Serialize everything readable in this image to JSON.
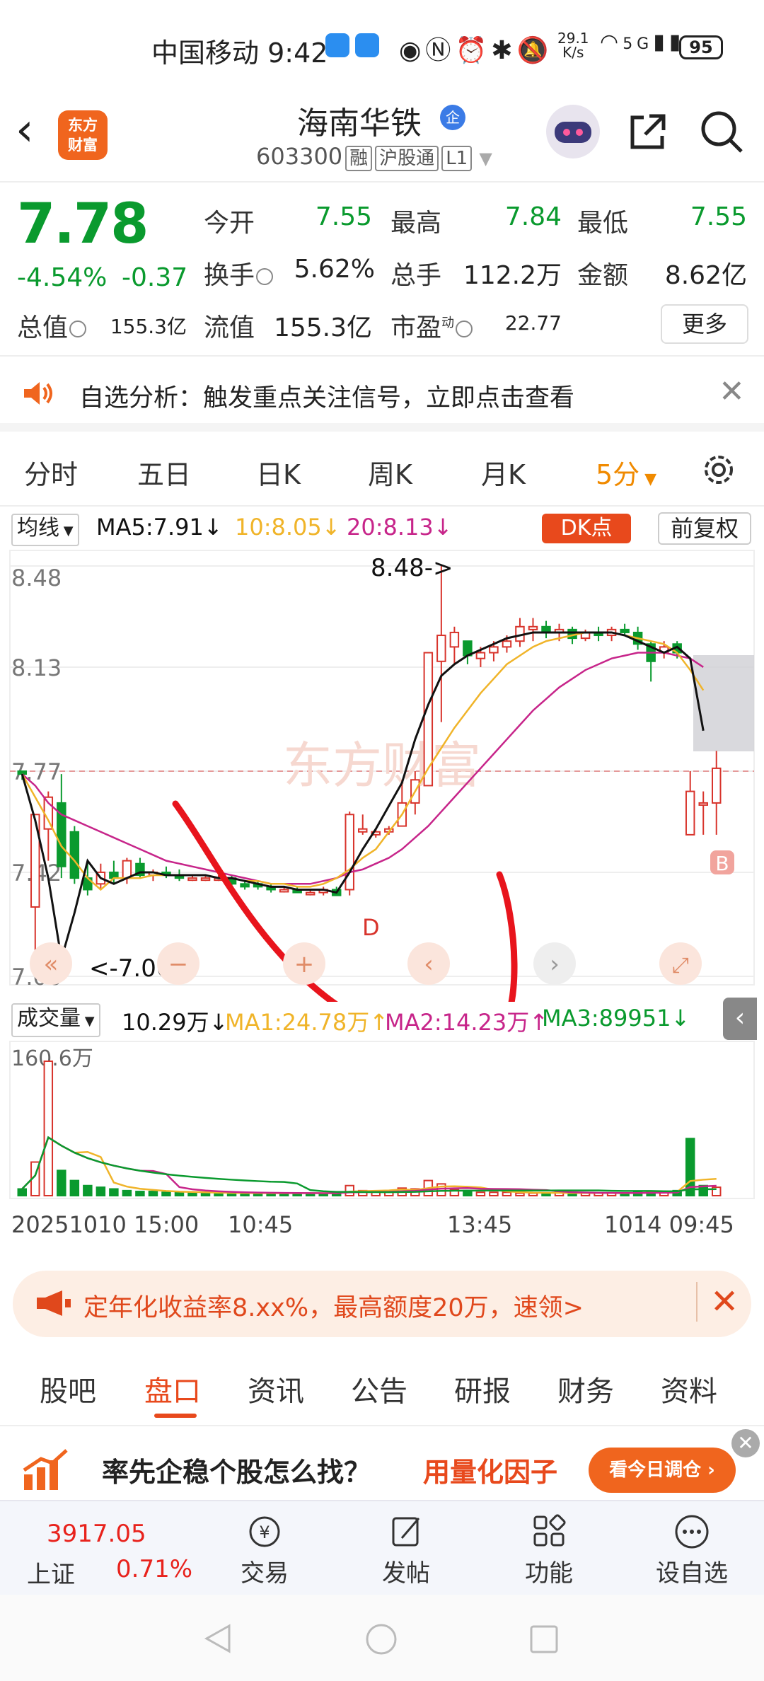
{
  "status_bar": {
    "carrier": "中国移动",
    "time": "9:42",
    "net_speed_value": "29.1",
    "net_speed_unit": "K/s",
    "network": "5G",
    "battery": "95"
  },
  "header": {
    "logo_line1": "东方",
    "logo_line2": "财富",
    "stock_name": "海南华铁",
    "ent_badge": "企",
    "stock_code": "603300",
    "tags": [
      "融",
      "沪股通",
      "L1"
    ]
  },
  "quote": {
    "price": "7.78",
    "change_pct": "-4.54%",
    "change_amt": "-0.37",
    "fields": [
      {
        "label": "今开",
        "value": "7.55"
      },
      {
        "label": "最高",
        "value": "7.84"
      },
      {
        "label": "最低",
        "value": "7.55"
      },
      {
        "label": "换手",
        "value": "5.62%"
      },
      {
        "label": "总手",
        "value": "112.2万"
      },
      {
        "label": "金额",
        "value": "8.62亿"
      },
      {
        "label": "总值",
        "value": "155.3亿"
      },
      {
        "label": "流值",
        "value": "155.3亿"
      },
      {
        "label": "市盈",
        "value": "22.77",
        "superscript": "动"
      }
    ],
    "more_button": "更多"
  },
  "notice": {
    "text": "自选分析：触发重点关注信号，立即点击查看"
  },
  "period_tabs": [
    "分时",
    "五日",
    "日K",
    "周K",
    "月K",
    "5分"
  ],
  "active_period": "5分",
  "chart_toolbar": {
    "ma_select": "均线",
    "ma5": "MA5:7.91↓",
    "ma10": "10:8.05↓",
    "ma20": "20:8.13↓",
    "dk_button": "DK点",
    "adjust_button": "前复权"
  },
  "chart_data": {
    "type": "candlestick",
    "y_labels": [
      "8.48",
      "8.13",
      "7.77",
      "7.42",
      "7.06"
    ],
    "ylim": [
      7.06,
      8.48
    ],
    "high_marker": "8.48->",
    "low_marker": "<-7.06",
    "watermark": "东方财富",
    "signal_D": "D",
    "signal_B": "B",
    "candles": [
      {
        "o": 7.77,
        "h": 7.77,
        "l": 7.74,
        "c": 7.76
      },
      {
        "o": 7.3,
        "h": 7.62,
        "l": 7.06,
        "c": 7.62
      },
      {
        "o": 7.57,
        "h": 7.7,
        "l": 7.46,
        "c": 7.68
      },
      {
        "o": 7.66,
        "h": 7.76,
        "l": 7.4,
        "c": 7.44
      },
      {
        "o": 7.56,
        "h": 7.58,
        "l": 7.38,
        "c": 7.4
      },
      {
        "o": 7.4,
        "h": 7.46,
        "l": 7.34,
        "c": 7.36
      },
      {
        "o": 7.38,
        "h": 7.45,
        "l": 7.36,
        "c": 7.42
      },
      {
        "o": 7.42,
        "h": 7.46,
        "l": 7.38,
        "c": 7.4
      },
      {
        "o": 7.4,
        "h": 7.47,
        "l": 7.38,
        "c": 7.46
      },
      {
        "o": 7.45,
        "h": 7.47,
        "l": 7.4,
        "c": 7.41
      },
      {
        "o": 7.41,
        "h": 7.43,
        "l": 7.39,
        "c": 7.42
      },
      {
        "o": 7.42,
        "h": 7.44,
        "l": 7.4,
        "c": 7.41
      },
      {
        "o": 7.41,
        "h": 7.43,
        "l": 7.39,
        "c": 7.4
      },
      {
        "o": 7.4,
        "h": 7.41,
        "l": 7.39,
        "c": 7.4
      },
      {
        "o": 7.4,
        "h": 7.41,
        "l": 7.39,
        "c": 7.4
      },
      {
        "o": 7.4,
        "h": 7.41,
        "l": 7.39,
        "c": 7.4
      },
      {
        "o": 7.4,
        "h": 7.41,
        "l": 7.37,
        "c": 7.38
      },
      {
        "o": 7.38,
        "h": 7.39,
        "l": 7.36,
        "c": 7.37
      },
      {
        "o": 7.38,
        "h": 7.39,
        "l": 7.36,
        "c": 7.37
      },
      {
        "o": 7.37,
        "h": 7.38,
        "l": 7.35,
        "c": 7.36
      },
      {
        "o": 7.36,
        "h": 7.37,
        "l": 7.35,
        "c": 7.36
      },
      {
        "o": 7.36,
        "h": 7.37,
        "l": 7.35,
        "c": 7.35
      },
      {
        "o": 7.35,
        "h": 7.36,
        "l": 7.34,
        "c": 7.35
      },
      {
        "o": 7.35,
        "h": 7.37,
        "l": 7.34,
        "c": 7.36
      },
      {
        "o": 7.36,
        "h": 7.37,
        "l": 7.34,
        "c": 7.34
      },
      {
        "o": 7.36,
        "h": 7.63,
        "l": 7.34,
        "c": 7.62
      },
      {
        "o": 7.56,
        "h": 7.62,
        "l": 7.55,
        "c": 7.57
      },
      {
        "o": 7.55,
        "h": 7.57,
        "l": 7.54,
        "c": 7.56
      },
      {
        "o": 7.56,
        "h": 7.58,
        "l": 7.55,
        "c": 7.57
      },
      {
        "o": 7.58,
        "h": 7.74,
        "l": 7.58,
        "c": 7.66
      },
      {
        "o": 7.66,
        "h": 7.77,
        "l": 7.62,
        "c": 7.74
      },
      {
        "o": 7.72,
        "h": 8.18,
        "l": 7.72,
        "c": 8.18
      },
      {
        "o": 8.15,
        "h": 8.48,
        "l": 7.94,
        "c": 8.24
      },
      {
        "o": 8.2,
        "h": 8.27,
        "l": 8.14,
        "c": 8.25
      },
      {
        "o": 8.22,
        "h": 8.22,
        "l": 8.14,
        "c": 8.17
      },
      {
        "o": 8.16,
        "h": 8.2,
        "l": 8.13,
        "c": 8.18
      },
      {
        "o": 8.18,
        "h": 8.22,
        "l": 8.15,
        "c": 8.2
      },
      {
        "o": 8.2,
        "h": 8.24,
        "l": 8.18,
        "c": 8.22
      },
      {
        "o": 8.22,
        "h": 8.3,
        "l": 8.2,
        "c": 8.27
      },
      {
        "o": 8.26,
        "h": 8.3,
        "l": 8.22,
        "c": 8.27
      },
      {
        "o": 8.27,
        "h": 8.29,
        "l": 8.23,
        "c": 8.25
      },
      {
        "o": 8.25,
        "h": 8.28,
        "l": 8.22,
        "c": 8.26
      },
      {
        "o": 8.26,
        "h": 8.27,
        "l": 8.21,
        "c": 8.23
      },
      {
        "o": 8.23,
        "h": 8.26,
        "l": 8.22,
        "c": 8.25
      },
      {
        "o": 8.25,
        "h": 8.27,
        "l": 8.22,
        "c": 8.24
      },
      {
        "o": 8.24,
        "h": 8.27,
        "l": 8.22,
        "c": 8.26
      },
      {
        "o": 8.26,
        "h": 8.28,
        "l": 8.24,
        "c": 8.25
      },
      {
        "o": 8.25,
        "h": 8.27,
        "l": 8.19,
        "c": 8.21
      },
      {
        "o": 8.21,
        "h": 8.22,
        "l": 8.08,
        "c": 8.15
      },
      {
        "o": 8.18,
        "h": 8.22,
        "l": 8.16,
        "c": 8.2
      },
      {
        "o": 8.21,
        "h": 8.22,
        "l": 8.16,
        "c": 8.18
      },
      {
        "o": 7.55,
        "h": 7.77,
        "l": 7.55,
        "c": 7.7
      },
      {
        "o": 7.66,
        "h": 7.7,
        "l": 7.55,
        "c": 7.66
      },
      {
        "o": 7.66,
        "h": 7.84,
        "l": 7.55,
        "c": 7.78
      }
    ],
    "ma5": [
      7.76,
      7.6,
      7.4,
      7.12,
      7.28,
      7.46,
      7.4,
      7.38,
      7.4,
      7.42,
      7.42,
      7.41,
      7.41,
      7.41,
      7.41,
      7.4,
      7.4,
      7.39,
      7.38,
      7.37,
      7.37,
      7.36,
      7.36,
      7.36,
      7.35,
      7.42,
      7.5,
      7.57,
      7.65,
      7.73,
      7.88,
      8.0,
      8.1,
      8.14,
      8.17,
      8.19,
      8.21,
      8.23,
      8.24,
      8.25,
      8.25,
      8.25,
      8.25,
      8.25,
      8.25,
      8.25,
      8.24,
      8.22,
      8.2,
      8.18,
      8.2,
      8.16,
      7.91
    ],
    "ma10": [
      7.76,
      7.68,
      7.6,
      7.51,
      7.46,
      7.4,
      7.36,
      7.4,
      7.4,
      7.4,
      7.41,
      7.41,
      7.41,
      7.41,
      7.41,
      7.4,
      7.4,
      7.39,
      7.39,
      7.38,
      7.38,
      7.37,
      7.37,
      7.38,
      7.4,
      7.43,
      7.47,
      7.5,
      7.56,
      7.62,
      7.7,
      7.78,
      7.85,
      7.92,
      7.98,
      8.04,
      8.09,
      8.14,
      8.17,
      8.2,
      8.22,
      8.23,
      8.24,
      8.25,
      8.25,
      8.25,
      8.24,
      8.23,
      8.22,
      8.21,
      8.18,
      8.12,
      8.05
    ],
    "ma20": [
      7.76,
      7.72,
      7.66,
      7.62,
      7.6,
      7.58,
      7.56,
      7.54,
      7.52,
      7.5,
      7.48,
      7.46,
      7.45,
      7.44,
      7.43,
      7.42,
      7.41,
      7.4,
      7.39,
      7.38,
      7.38,
      7.38,
      7.38,
      7.39,
      7.4,
      7.42,
      7.43,
      7.45,
      7.47,
      7.5,
      7.54,
      7.58,
      7.63,
      7.68,
      7.73,
      7.78,
      7.83,
      7.88,
      7.93,
      7.98,
      8.02,
      8.06,
      8.09,
      8.12,
      8.14,
      8.16,
      8.17,
      8.18,
      8.18,
      8.18,
      8.17,
      8.16,
      8.13
    ],
    "ref_price": 7.77,
    "ref_candle_split": 51
  },
  "volume": {
    "select": "成交量",
    "current": "10.29万↓",
    "ma1": "MA1:24.78万↑",
    "ma2": "MA2:14.23万↑",
    "ma3": "MA3:89951↓",
    "max_label": "160.6万",
    "x_labels": [
      "20251010 15:00",
      "10:45",
      "13:45",
      "1014 09:45"
    ],
    "bars": [
      8,
      40,
      160,
      30,
      18,
      12,
      10,
      8,
      6,
      5,
      5,
      4,
      4,
      4,
      3,
      3,
      3,
      3,
      3,
      3,
      3,
      3,
      3,
      3,
      3,
      12,
      6,
      5,
      5,
      9,
      8,
      18,
      14,
      7,
      6,
      4,
      4,
      4,
      3,
      3,
      3,
      4,
      3,
      3,
      3,
      3,
      3,
      4,
      5,
      4,
      6,
      68,
      12,
      10
    ],
    "bar_up": [
      false,
      true,
      true,
      false,
      false,
      false,
      false,
      false,
      false,
      false,
      false,
      false,
      false,
      false,
      false,
      false,
      false,
      false,
      false,
      false,
      false,
      false,
      false,
      false,
      false,
      true,
      true,
      true,
      true,
      true,
      true,
      true,
      true,
      true,
      false,
      true,
      true,
      true,
      true,
      true,
      false,
      true,
      false,
      true,
      true,
      true,
      false,
      false,
      false,
      true,
      false,
      false,
      false,
      true
    ]
  },
  "chart_controls": [
    "«",
    "−",
    "+",
    "‹",
    "›",
    "⤢"
  ],
  "promo": {
    "text": "定年化收益率8.xx%，最高额度20万，速领>"
  },
  "content_tabs": [
    "股吧",
    "盘口",
    "资讯",
    "公告",
    "研报",
    "财务",
    "资料"
  ],
  "active_content_tab": "盘口",
  "ad": {
    "text": "率先企稳个股怎么找？",
    "highlight": "用量化因子",
    "button": "看今日调仓 ›"
  },
  "bottom_nav": {
    "index_value": "3917.05",
    "index_name": "上证",
    "index_pct": "0.71%",
    "items": [
      "交易",
      "发帖",
      "功能",
      "设自选"
    ]
  },
  "colors": {
    "up": "#d8342c",
    "down": "#0a9a2e",
    "accent": "#f08a00",
    "brand": "#f0651e",
    "ma5": "#111111",
    "ma10": "#f0b429",
    "ma20": "#c7258a"
  }
}
